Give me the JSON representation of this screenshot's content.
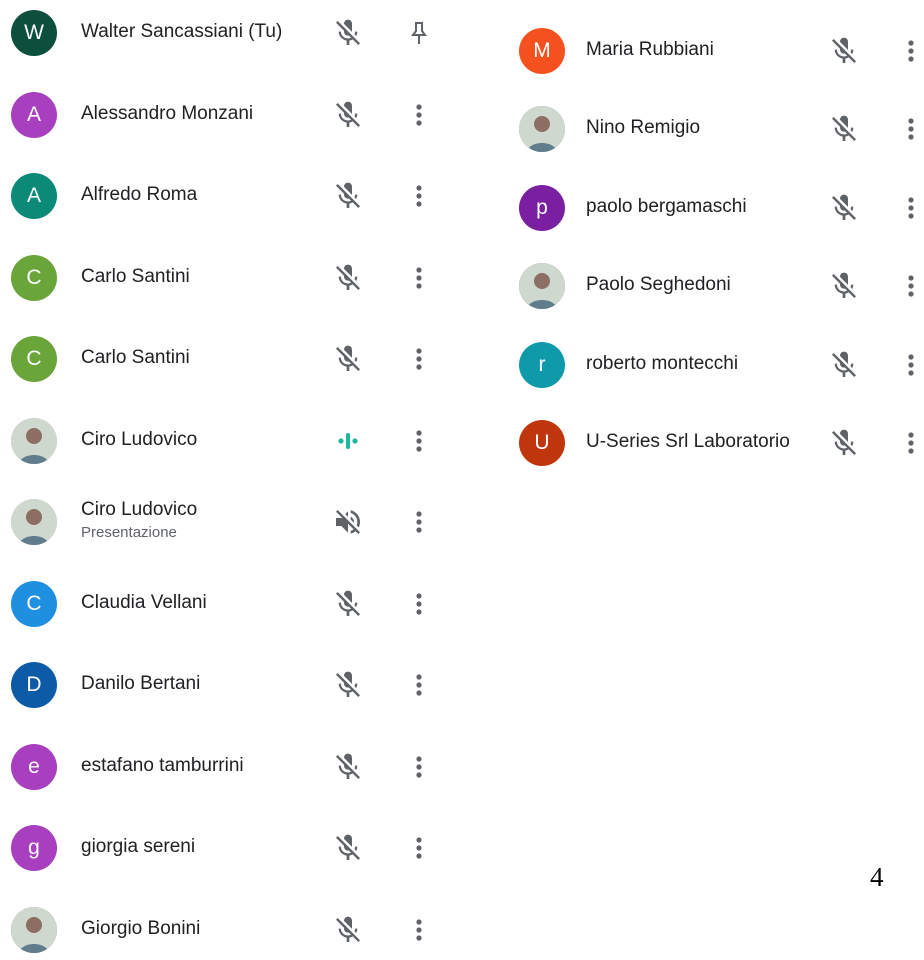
{
  "participants_left": [
    {
      "name": "Walter Sancassiani (Tu)",
      "initial": "W",
      "color": "#0b4f3c",
      "action": "pin-icon",
      "mic": "mic-off-icon"
    },
    {
      "name": "Alessandro Monzani",
      "initial": "A",
      "color": "#a83fbf",
      "action": "more-options-icon",
      "mic": "mic-off-icon"
    },
    {
      "name": "Alfredo Roma",
      "initial": "A",
      "color": "#0a8a77",
      "action": "more-options-icon",
      "mic": "mic-off-icon"
    },
    {
      "name": "Carlo Santini",
      "initial": "C",
      "color": "#6aa53a",
      "action": "more-options-icon",
      "mic": "mic-off-icon"
    },
    {
      "name": "Carlo Santini",
      "initial": "C",
      "color": "#6aa53a",
      "action": "more-options-icon",
      "mic": "mic-off-icon"
    },
    {
      "name": "Ciro Ludovico",
      "initial": "",
      "color": "#c9b79c",
      "photo": true,
      "action": "more-options-icon",
      "mic": "speaking-indicator-icon"
    },
    {
      "name": "Ciro Ludovico",
      "subtitle": "Presentazione",
      "initial": "",
      "color": "#c9b79c",
      "photo": true,
      "action": "more-options-icon",
      "mic": "volume-off-icon"
    },
    {
      "name": "Claudia Vellani",
      "initial": "C",
      "color": "#1f8fe0",
      "action": "more-options-icon",
      "mic": "mic-off-icon"
    },
    {
      "name": "Danilo Bertani",
      "initial": "D",
      "color": "#0d5aa7",
      "action": "more-options-icon",
      "mic": "mic-off-icon"
    },
    {
      "name": "estafano tamburrini",
      "initial": "e",
      "color": "#a83fbf",
      "action": "more-options-icon",
      "mic": "mic-off-icon"
    },
    {
      "name": "giorgia sereni",
      "initial": "g",
      "color": "#a83fbf",
      "action": "more-options-icon",
      "mic": "mic-off-icon"
    },
    {
      "name": "Giorgio Bonini",
      "initial": "",
      "color": "#8a6e5a",
      "photo": true,
      "action": "more-options-icon",
      "mic": "mic-off-icon"
    }
  ],
  "participants_right": [
    {
      "name": "Maria Rubbiani",
      "initial": "M",
      "color": "#f4511e",
      "action": "more-options-icon",
      "mic": "mic-off-icon"
    },
    {
      "name": "Nino Remigio",
      "initial": "",
      "color": "#6d8a6a",
      "photo": true,
      "action": "more-options-icon",
      "mic": "mic-off-icon"
    },
    {
      "name": "paolo bergamaschi",
      "initial": "p",
      "color": "#7b1fa2",
      "action": "more-options-icon",
      "mic": "mic-off-icon"
    },
    {
      "name": "Paolo Seghedoni",
      "initial": "",
      "color": "#8d6e63",
      "photo": true,
      "action": "more-options-icon",
      "mic": "mic-off-icon"
    },
    {
      "name": "roberto montecchi",
      "initial": "r",
      "color": "#0f9aaa",
      "action": "more-options-icon",
      "mic": "mic-off-icon"
    },
    {
      "name": "U-Series Srl Laboratorio",
      "initial": "U",
      "color": "#bf360c",
      "action": "more-options-icon",
      "mic": "mic-off-icon"
    }
  ],
  "page_number": "4",
  "colors": {
    "icon": "#5f6368",
    "speaking": "#1fb89a"
  }
}
